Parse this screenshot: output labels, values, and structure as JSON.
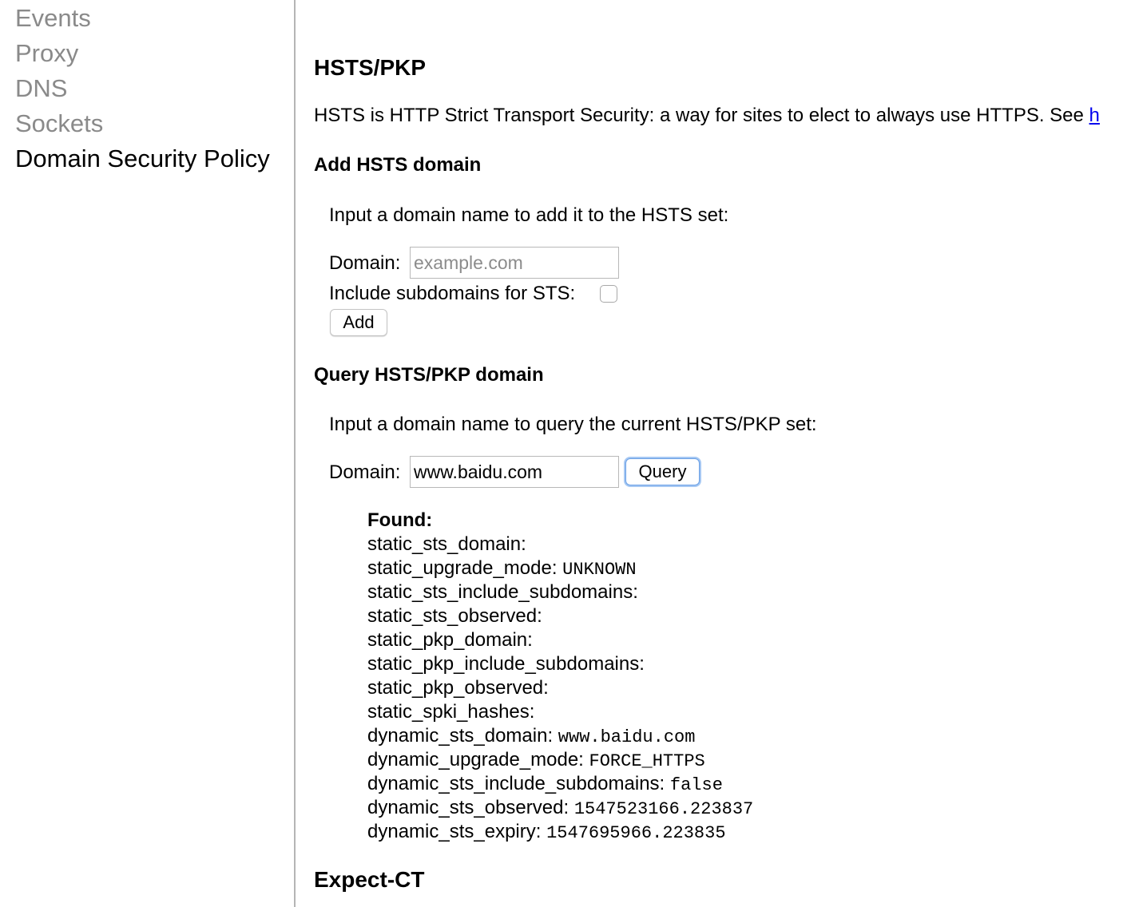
{
  "sidebar": {
    "items": [
      {
        "label": "Events",
        "selected": false
      },
      {
        "label": "Proxy",
        "selected": false
      },
      {
        "label": "DNS",
        "selected": false
      },
      {
        "label": "Sockets",
        "selected": false
      },
      {
        "label": "Domain Security Policy",
        "selected": true
      }
    ]
  },
  "main": {
    "hsts_title": "HSTS/PKP",
    "hsts_description": "HSTS is HTTP Strict Transport Security: a way for sites to elect to always use HTTPS. See ",
    "hsts_description_link": "h",
    "add_section": {
      "title": "Add HSTS domain",
      "instruction": "Input a domain name to add it to the HSTS set:",
      "domain_label": "Domain:",
      "domain_placeholder": "example.com",
      "domain_value": "",
      "subdomains_label": "Include subdomains for STS:",
      "subdomains_checked": false,
      "add_button": "Add"
    },
    "query_section": {
      "title": "Query HSTS/PKP domain",
      "instruction": "Input a domain name to query the current HSTS/PKP set:",
      "domain_label": "Domain:",
      "domain_value": "www.baidu.com",
      "query_button": "Query",
      "result_header": "Found:",
      "results": [
        {
          "key": "static_sts_domain:",
          "value": ""
        },
        {
          "key": "static_upgrade_mode:",
          "value": "UNKNOWN"
        },
        {
          "key": "static_sts_include_subdomains:",
          "value": ""
        },
        {
          "key": "static_sts_observed:",
          "value": ""
        },
        {
          "key": "static_pkp_domain:",
          "value": ""
        },
        {
          "key": "static_pkp_include_subdomains:",
          "value": ""
        },
        {
          "key": "static_pkp_observed:",
          "value": ""
        },
        {
          "key": "static_spki_hashes:",
          "value": ""
        },
        {
          "key": "dynamic_sts_domain:",
          "value": "www.baidu.com"
        },
        {
          "key": "dynamic_upgrade_mode:",
          "value": "FORCE_HTTPS"
        },
        {
          "key": "dynamic_sts_include_subdomains:",
          "value": "false"
        },
        {
          "key": "dynamic_sts_observed:",
          "value": "1547523166.223837"
        },
        {
          "key": "dynamic_sts_expiry:",
          "value": "1547695966.223835"
        }
      ]
    },
    "expect_ct_title": "Expect-CT"
  }
}
